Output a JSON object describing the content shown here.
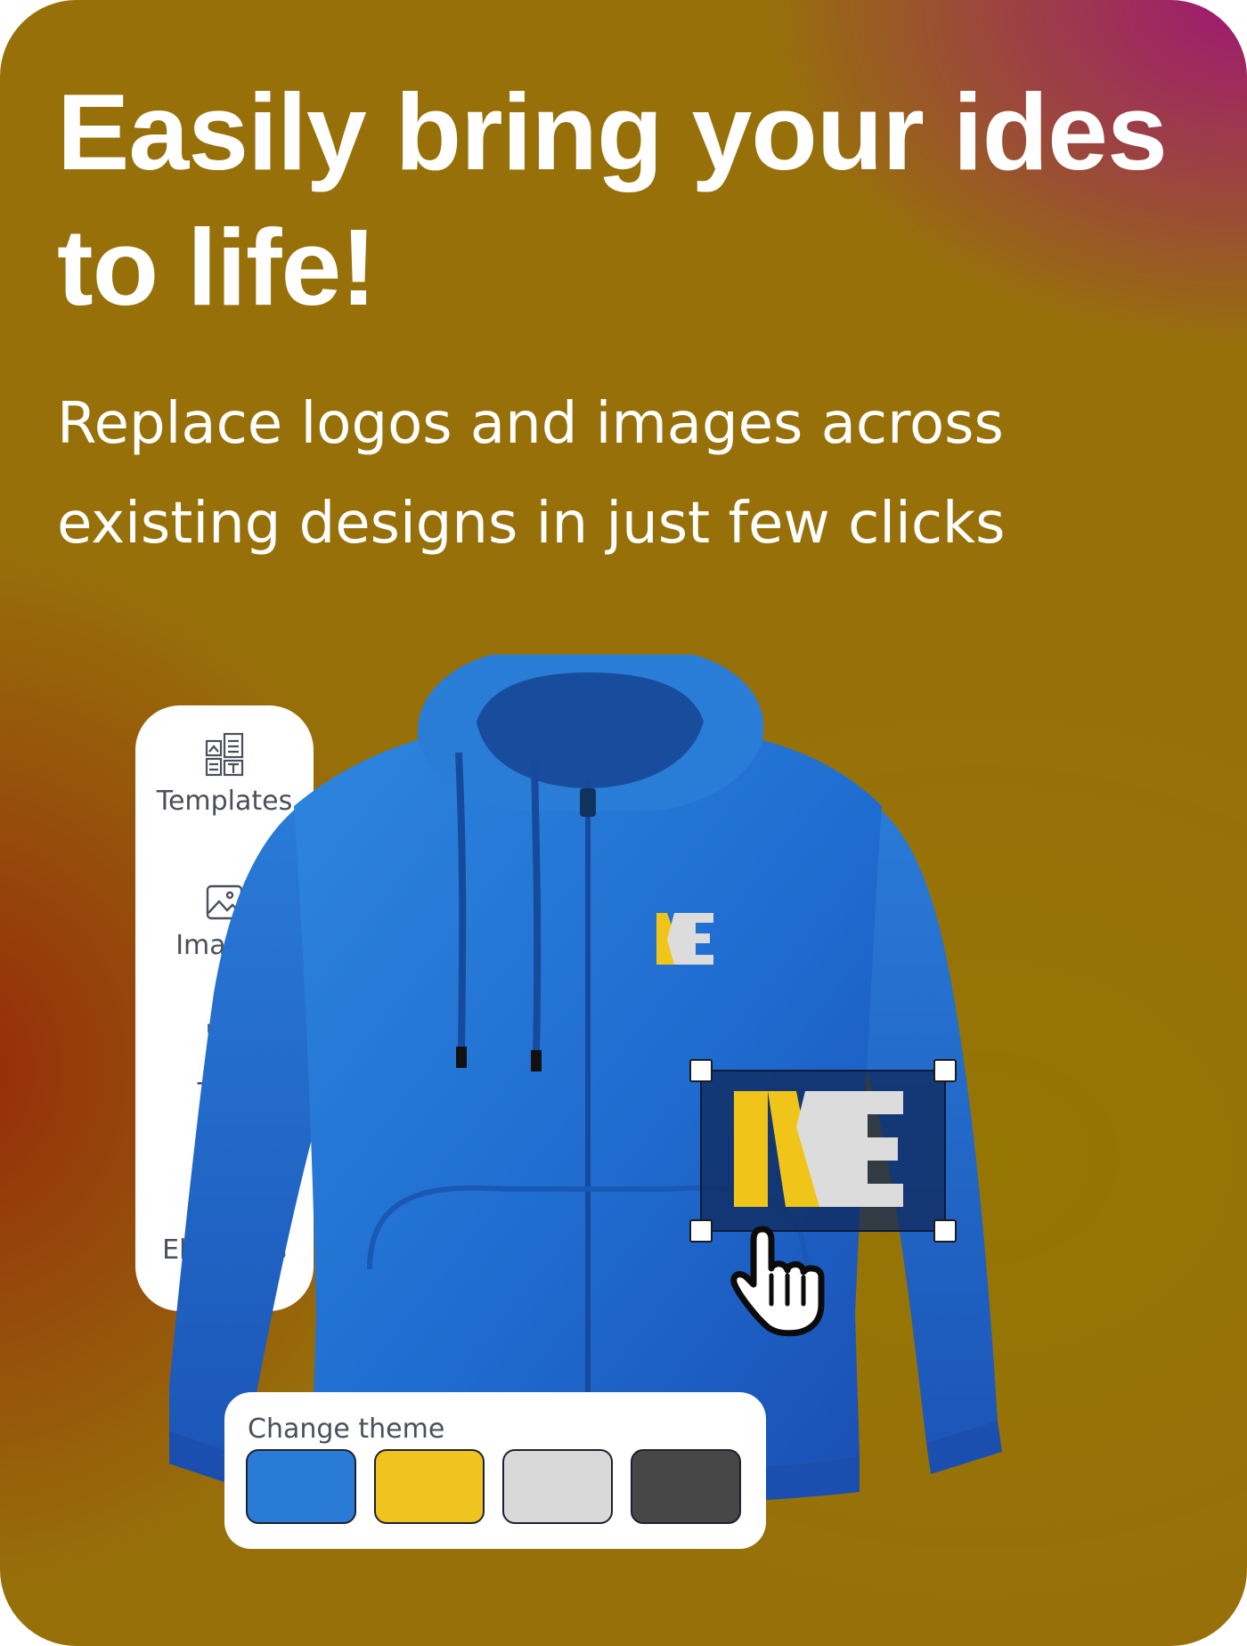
{
  "headline": "Easily bring your ides to life!",
  "subheadline": "Replace logos and images across existing designs in just few clicks",
  "tools": [
    {
      "label": "Templates",
      "icon": "templates-icon"
    },
    {
      "label": "Images",
      "icon": "image-icon"
    },
    {
      "label": "Text",
      "icon": "text-icon"
    },
    {
      "label": "Elements",
      "icon": "elements-icon"
    }
  ],
  "product": {
    "name": "hoodie",
    "logo_text": "ME",
    "colors": {
      "body": "#1f6fd1",
      "logo_primary": "#f0c419",
      "logo_secondary": "#dcdcdc"
    }
  },
  "theme_panel": {
    "title": "Change theme",
    "swatches": [
      {
        "name": "blue",
        "color": "#2a7bd5"
      },
      {
        "name": "yellow",
        "color": "#f0c41e"
      },
      {
        "name": "light-gray",
        "color": "#d9d9d9"
      },
      {
        "name": "dark-gray",
        "color": "#474747"
      }
    ]
  },
  "cursor": "hand-pointer-icon"
}
